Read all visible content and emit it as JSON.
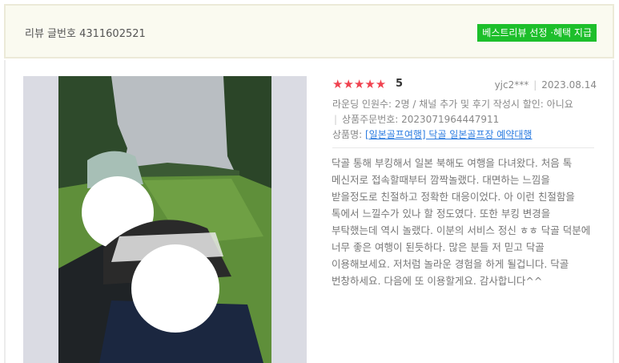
{
  "header": {
    "review_number": "리뷰 글번호 4311602521",
    "badge": "베스트리뷰 선정 ·혜택 지급"
  },
  "review": {
    "stars": "★★★★★",
    "rating": "5",
    "author": "yjc2***",
    "date": "2023.08.14",
    "info_line": "라운딩 인원수: 2명 / 채널 추가 및 후기 작성시 할인: 아니요",
    "order_no": "상품주문번호: 2023071964447911",
    "product_label": "상품명: ",
    "product_link": "[일본골프여행] 닥골 일본골프장 예약대행",
    "content": "닥골 통해 부킹해서 일본 북해도 여행을 다녀왔다. 처음 톡 메신저로 접속할때부터 깜짝놀랬다. 대면하는 느낌을 받을정도로 친절하고 정확한 대응이었다. 아 이런 친절함을 톡에서 느낄수가 있나 할 정도였다. 또한 부킹 변경을 부탁했는데 역시 놀랬다. 이분의 서비스 정신 ㅎㅎ 닥골 덕분에 너무 좋은 여행이 된듯하다. 많은 분들 저 믿고 닥골 이용해보세요. 저처럼 놀라운 경험을 하게 될겁니다. 닥골 번창하세요. 다음에 또 이용할게요. 감사합니다^^"
  },
  "colors": {
    "badge_bg": "#1dbf2b",
    "star": "#f0424f",
    "link": "#2a7be0",
    "header_bg": "#fafaf0"
  }
}
